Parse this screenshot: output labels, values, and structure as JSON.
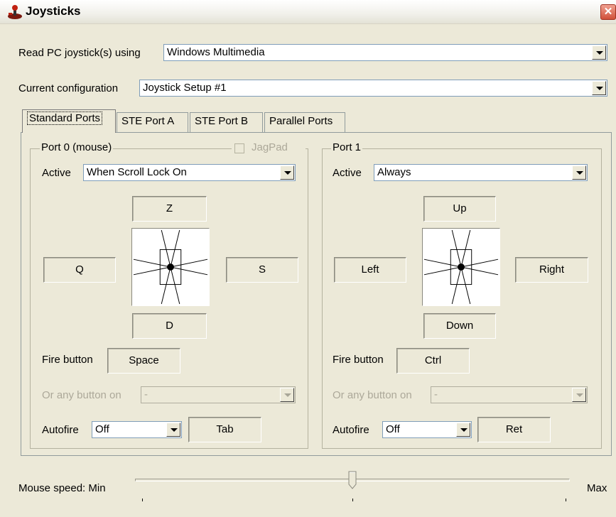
{
  "window": {
    "title": "Joystick s"
  },
  "titlebar": {
    "title": "Joysticks",
    "close_glyph": "✕",
    "app_icon": "joystick-icon"
  },
  "read_using": {
    "label": "Read PC joystick(s) using",
    "value": "Windows Multimedia"
  },
  "current_config": {
    "label": "Current configuration",
    "value": "Joystick Setup #1"
  },
  "tabs": [
    {
      "label": "Standard Ports",
      "active": true
    },
    {
      "label": "STE Port A",
      "active": false
    },
    {
      "label": "STE Port B",
      "active": false
    },
    {
      "label": "Parallel Ports",
      "active": false
    }
  ],
  "port0": {
    "title": "Port 0 (mouse)",
    "jagpad_label": "JagPad",
    "active_label": "Active",
    "active_value": "When Scroll Lock On",
    "up": "Z",
    "down": "D",
    "left": "Q",
    "right": "S",
    "fire_label": "Fire button",
    "fire_value": "Space",
    "any_button_label": "Or any button on",
    "any_button_value": "-",
    "autofire_label": "Autofire",
    "autofire_value": "Off",
    "autofire_key": "Tab"
  },
  "port1": {
    "title": "Port 1",
    "active_label": "Active",
    "active_value": "Always",
    "up": "Up",
    "down": "Down",
    "left": "Left",
    "right": "Right",
    "fire_label": "Fire button",
    "fire_value": "Ctrl",
    "any_button_label": "Or any button on",
    "any_button_value": "-",
    "autofire_label": "Autofire",
    "autofire_value": "Off",
    "autofire_key": "Ret"
  },
  "mouse_speed": {
    "label": "Mouse speed: Min",
    "max_label": "Max",
    "level": 0.5
  },
  "colors": {
    "window_bg": "#ECE9D8",
    "close_red": "#d0503a",
    "border_blue": "#7f9db9"
  }
}
